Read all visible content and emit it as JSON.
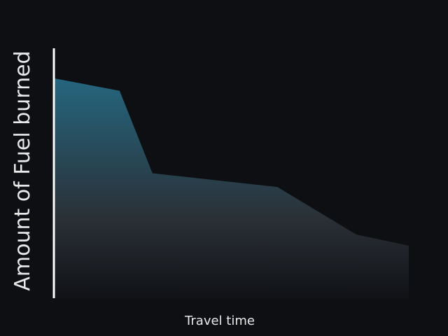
{
  "chart_data": {
    "type": "area",
    "title": "",
    "xlabel": "Travel time",
    "ylabel": "Amount of Fuel burned",
    "x": [
      0,
      1,
      1.5,
      3.4,
      4.6,
      5.4
    ],
    "values": [
      0.88,
      0.83,
      0.5,
      0.445,
      0.255,
      0.21
    ],
    "xlim": [
      0,
      5.4
    ],
    "ylim": [
      0,
      1
    ],
    "grid": false,
    "legend": "none",
    "colors": {
      "background": "#0d0f13",
      "fill_top": "#25667f",
      "fill_bottom": "#101216",
      "axis": "#ffffff",
      "text": "#e8e8e8"
    }
  }
}
